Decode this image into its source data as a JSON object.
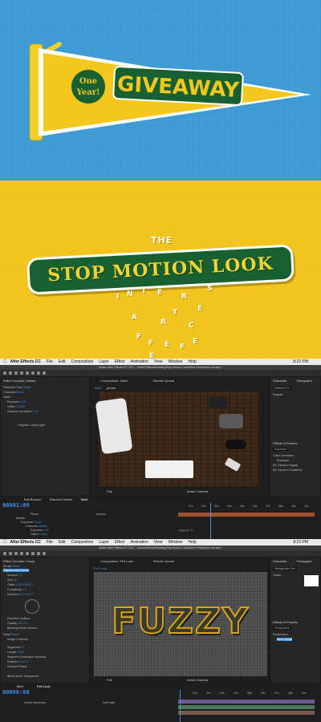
{
  "giveaway": {
    "badge_line1": "One",
    "badge_line2": "Year!",
    "pennant_text": "GIVEAWAY"
  },
  "stop_motion": {
    "the_label": "THE",
    "title": "STOP MOTION LOOK",
    "falling_letters": [
      "I",
      "N",
      "T",
      "E",
      "R",
      "S",
      "E",
      "T",
      "A",
      "R",
      "C",
      "T",
      "A",
      "F",
      "F",
      "E",
      "F",
      "E",
      "E"
    ]
  },
  "ae_top": {
    "menu": [
      "After Effects CC",
      "File",
      "Edit",
      "Composition",
      "Layer",
      "Effect",
      "Animation",
      "View",
      "Window",
      "Help"
    ],
    "clock": "8:22 PM",
    "title": "Adobe After Effects CC 2017 - /Users/PaharaReading/Stop Motion Look/stitch FinalAnimLook.aep *",
    "effect_panel_tab": "Effect Controls: Motion",
    "comp_tab": "Composition: Table",
    "render_tab": "Render Queue",
    "comp_name": "Table",
    "comp_sub": "phone",
    "effects": [
      {
        "label": "Posterize Time",
        "value": "Reset"
      },
      {
        "label": "Channels",
        "value": "Monte"
      },
      {
        "label": "Noise",
        "value": ""
      },
      {
        "label": "Exposure",
        "value": "0.00"
      },
      {
        "label": "Offset",
        "value": "0.0000"
      },
      {
        "label": "Gamma Correction",
        "value": "1.00"
      },
      {
        "label": "Bypass Linear Light",
        "value": ""
      }
    ],
    "right_panels": [
      "Character",
      "Paragraph",
      "Effects & Presets",
      "Exposure"
    ],
    "font_name": "Marked Pro",
    "font_style": "Regular",
    "preset_items": [
      "Color Correction",
      "Exposure",
      "AE Camera Legacy",
      "AE Camera Transitions"
    ],
    "timecode": "00001:09",
    "timeline_tabs": [
      "Ball Bounce",
      "Random Motion",
      "Table"
    ],
    "layer_name": "Phone",
    "layer_mode": "Normal",
    "layer_props": [
      {
        "label": "Effects",
        "value": ""
      },
      {
        "label": "Exposure",
        "value": "Reset"
      },
      {
        "label": "Channels",
        "value": "Master"
      },
      {
        "label": "Master",
        "value": ""
      },
      {
        "label": "Exposure",
        "value": "0.00"
      },
      {
        "label": "Expression: Exposure",
        "value": "wiggle(8,.5)"
      },
      {
        "label": "Offset",
        "value": "0.0000"
      },
      {
        "label": "Gamma Correction",
        "value": "1.00"
      }
    ],
    "expression": "wiggle(8,.5)",
    "zoom": "Full",
    "view": "Active Camera",
    "ruler": [
      "01s",
      "02s",
      "03s",
      "04s",
      "05s",
      "06s",
      "07s",
      "08s",
      "09s",
      "10s"
    ]
  },
  "ae_bottom": {
    "menu": [
      "After Effects CC",
      "File",
      "Edit",
      "Composition",
      "Layer",
      "Effect",
      "Animation",
      "View",
      "Window",
      "Help"
    ],
    "clock": "8:23 PM",
    "title": "Adobe After Effects CC 2017 - /Users/PaharaReading/Stop Motion Look/stitch FinalAnimLook.aep *",
    "effect_panel_tab": "Effect Controls: Fuzzy",
    "comp_tab": "Composition: Felt Look",
    "render_tab": "Render Queue",
    "comp_sub": "Felt Look",
    "fuzzy_text": "FUZZY",
    "effects": [
      {
        "label": "Stroke",
        "value": "Reset"
      },
      {
        "label": "Displacement",
        "value": "Reset"
      },
      {
        "label": "Amount",
        "value": "0.0"
      },
      {
        "label": "Size",
        "value": "10"
      },
      {
        "label": "Offset",
        "value": "1200.0,652.0"
      },
      {
        "label": "Complexity",
        "value": "1.0"
      },
      {
        "label": "Evolution",
        "value": "0x+125.0°"
      },
      {
        "label": "Evolution Options",
        "value": ""
      },
      {
        "label": "Opacity",
        "value": "100.0%"
      },
      {
        "label": "Blending Mode",
        "value": "Normal"
      },
      {
        "label": "Noise",
        "value": "Reset"
      },
      {
        "label": "Image Contours",
        "value": ""
      },
      {
        "label": "Segments",
        "value": "47"
      },
      {
        "label": "Length",
        "value": "0.015"
      },
      {
        "label": "Segment Distribution",
        "value": "Bunched"
      },
      {
        "label": "Rotation",
        "value": "0x+0.0°"
      },
      {
        "label": "Random Phase",
        "value": ""
      },
      {
        "label": "Blend Mode",
        "value": "Transparent"
      }
    ],
    "right_panels": [
      "Character",
      "Paragraph",
      "Effects & Presets",
      "Perspective"
    ],
    "font_name": "Refrigerator Dec",
    "font_style": "Heavy",
    "preset_items": [
      "Perspective",
      "Bevel Alpha"
    ],
    "timecode": "00000:00",
    "timeline_tabs": [
      "Table",
      "Felt Look"
    ],
    "layer_name": "Linear Stickiness",
    "layer_mode": "Soft Light",
    "zoom": "Full",
    "view": "Active Camera",
    "ruler": [
      "01s",
      "02s",
      "03s",
      "04s",
      "05s",
      "06s",
      "07s",
      "08s",
      "09s"
    ]
  },
  "colors": {
    "sky_blue": "#3a99d3",
    "felt_yellow": "#f1c316",
    "felt_green": "#17602f",
    "ae_blue": "#3d8fe0",
    "ae_bg": "#232323"
  }
}
